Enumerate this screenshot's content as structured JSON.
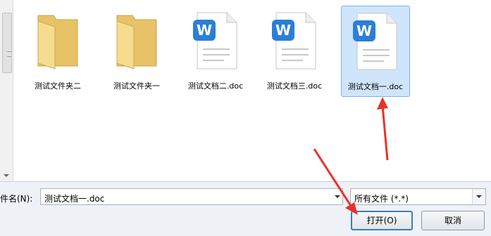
{
  "files": [
    {
      "name": "测试文件夹二",
      "kind": "folder",
      "selected": false
    },
    {
      "name": "测试文件夹一",
      "kind": "folder",
      "selected": false
    },
    {
      "name": "测试文档二.doc",
      "kind": "doc",
      "selected": false
    },
    {
      "name": "测试文档三.doc",
      "kind": "doc",
      "selected": false
    },
    {
      "name": "测试文档一.doc",
      "kind": "doc",
      "selected": true
    }
  ],
  "filename": {
    "label": "件名(N):",
    "value": "测试文档一.doc"
  },
  "file_type": {
    "selected": "所有文件 (*.*)"
  },
  "buttons": {
    "open": "打开(O)",
    "cancel": "取消"
  },
  "colors": {
    "folder": "#f2d27a",
    "doc_icon": "#2b7fd6",
    "selection": "#cfe5fb",
    "annotation_arrow": "#e8322b"
  }
}
